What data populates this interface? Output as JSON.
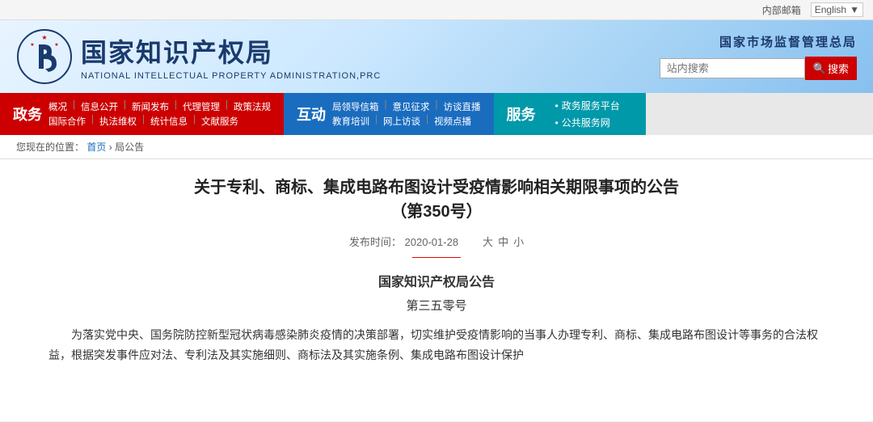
{
  "topbar": {
    "internal_mail": "内部邮箱",
    "language": "English"
  },
  "header": {
    "logo_zh": "国家知识产权局",
    "logo_en": "NATIONAL INTELLECTUAL PROPERTY ADMINISTRATION,PRC",
    "authority": "国家市场监督管理总局",
    "search_placeholder": "站内搜索",
    "search_btn": "搜索"
  },
  "nav": {
    "items": [
      {
        "label": "政务",
        "color": "active-red",
        "sub1": [
          "概况",
          "信息公开",
          "新闻发布",
          "代理管理",
          "政策法规"
        ],
        "sub2": [
          "国际合作",
          "执法维权",
          "统计信息",
          "文献服务"
        ]
      },
      {
        "label": "互动",
        "color": "active-blue",
        "sub1": [
          "局领导信箱",
          "意见征求",
          "访谈直播"
        ],
        "sub2": [
          "教育培训",
          "网上访谈",
          "视频点播"
        ]
      },
      {
        "label": "服务",
        "color": "active-teal",
        "links": [
          "政务服务平台",
          "公共服务网"
        ]
      }
    ]
  },
  "breadcrumb": {
    "location": "您现在的位置：",
    "home": "首页",
    "separator": "›",
    "current": "局公告"
  },
  "article": {
    "title": "关于专利、商标、集成电路布图设计受疫情影响相关期限事项的公告",
    "subtitle": "（第350号）",
    "date_label": "发布时间：",
    "date": "2020-01-28",
    "font_large": "大",
    "font_medium": "中",
    "font_small": "小",
    "section_title": "国家知识产权局公告",
    "section_num": "第三五零号",
    "body": "为落实党中央、国务院防控新型冠状病毒感染肺炎疫情的决策部署，切实维护受疫情影响的当事人办理专利、商标、集成电路布图设计等事务的合法权益，根据突发事件应对法、专利法及其实施细则、商标法及其实施条例、集成电路布图设计保护"
  }
}
